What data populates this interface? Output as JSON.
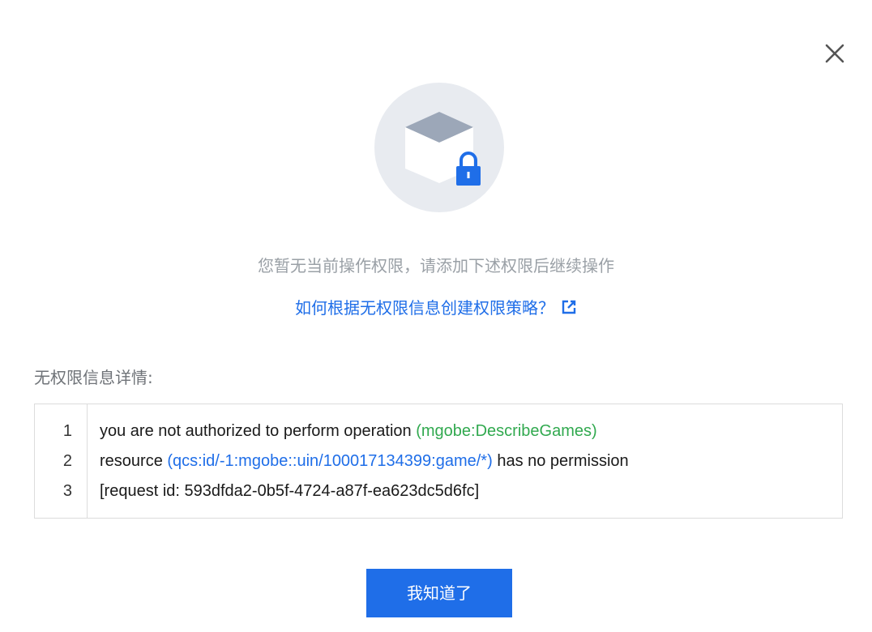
{
  "dialog": {
    "close_icon": "close-icon",
    "illustration_icon": "locked-box-icon",
    "message": "您暂无当前操作权限，请添加下述权限后继续操作",
    "help_link": "如何根据无权限信息创建权限策略？",
    "help_link_icon": "external-link-icon",
    "detail_label": "无权限信息详情:",
    "details": {
      "line_numbers": [
        "1",
        "2",
        "3"
      ],
      "line1_text": "you are not authorized to perform operation ",
      "line1_highlight": "(mgobe:DescribeGames)",
      "line2_prefix": "resource ",
      "line2_highlight": "(qcs:id/-1:mgobe::uin/100017134399:game/*)",
      "line2_suffix": " has no permission",
      "line3_text": "[request id: 593dfda2-0b5f-4724-a87f-ea623dc5d6fc]"
    },
    "confirm_button": "我知道了"
  },
  "colors": {
    "accent": "#1f6ee8",
    "action_highlight": "#31a94f",
    "muted_text": "#9aa0a6"
  }
}
